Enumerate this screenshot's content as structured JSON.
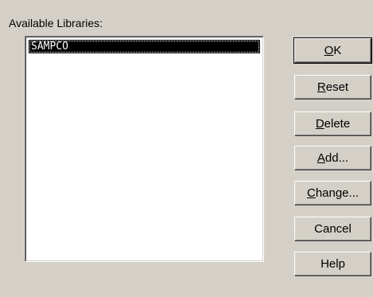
{
  "dialog": {
    "list_label": "Available Libraries:",
    "libraries": [
      "SAMPCO"
    ]
  },
  "buttons": {
    "ok": {
      "mnemonic": "O",
      "rest": "K"
    },
    "reset": {
      "mnemonic": "R",
      "rest": "eset"
    },
    "delete": {
      "mnemonic": "D",
      "rest": "elete"
    },
    "add": {
      "mnemonic": "A",
      "rest": "dd..."
    },
    "change": {
      "mnemonic": "C",
      "rest": "hange..."
    },
    "cancel": {
      "label": "Cancel"
    },
    "help": {
      "label": "Help"
    }
  }
}
